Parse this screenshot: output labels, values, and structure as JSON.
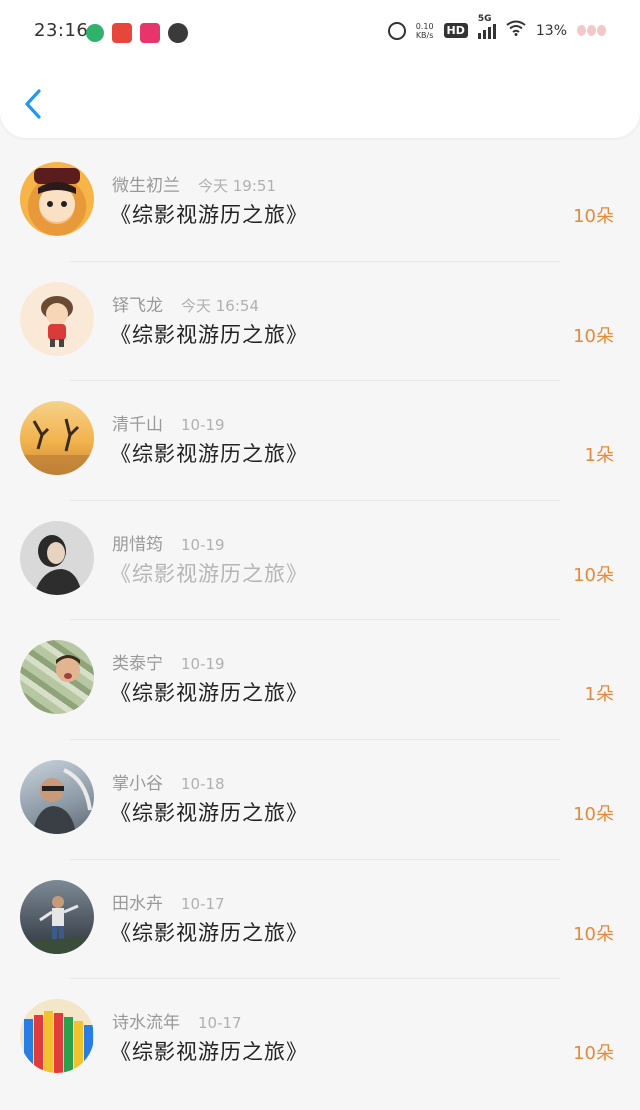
{
  "status_bar": {
    "time": "23:16",
    "network_speed": "0.10\nKB/s",
    "hd_label": "HD",
    "signal_label": "5G",
    "battery_percent": "13%"
  },
  "header": {
    "back_icon": "chevron-left-icon"
  },
  "colors": {
    "accent": "#2196f3",
    "amount": "#e8893a"
  },
  "items": [
    {
      "name": "微生初兰",
      "date": "今天 19:51",
      "title": "《综影视游历之旅》",
      "amount": "10朵",
      "faded": false
    },
    {
      "name": "铎飞龙",
      "date": "今天 16:54",
      "title": "《综影视游历之旅》",
      "amount": "10朵",
      "faded": false
    },
    {
      "name": "清千山",
      "date": "10-19",
      "title": "《综影视游历之旅》",
      "amount": "1朵",
      "faded": false
    },
    {
      "name": "朋惜筠",
      "date": "10-19",
      "title": "《综影视游历之旅》",
      "amount": "10朵",
      "faded": true
    },
    {
      "name": "类泰宁",
      "date": "10-19",
      "title": "《综影视游历之旅》",
      "amount": "1朵",
      "faded": false
    },
    {
      "name": "掌小谷",
      "date": "10-18",
      "title": "《综影视游历之旅》",
      "amount": "10朵",
      "faded": false
    },
    {
      "name": "田水卉",
      "date": "10-17",
      "title": "《综影视游历之旅》",
      "amount": "10朵",
      "faded": false
    },
    {
      "name": "诗水流年",
      "date": "10-17",
      "title": "《综影视游历之旅》",
      "amount": "10朵",
      "faded": false
    }
  ]
}
